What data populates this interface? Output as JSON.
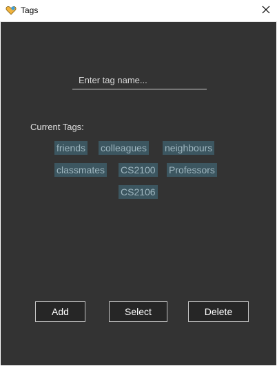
{
  "window": {
    "title": "Tags",
    "close_icon": "close-icon",
    "app_icon": "heart-app-icon",
    "app_icon_colors": [
      "#f2b33d",
      "#3aa0e0"
    ]
  },
  "input": {
    "placeholder": "Enter tag name...",
    "value": ""
  },
  "current_tags_label": "Current Tags:",
  "tags": [
    "friends",
    "colleagues",
    "neighbours",
    "classmates",
    "CS2100",
    "Professors",
    "CS2106"
  ],
  "buttons": {
    "add": "Add",
    "select": "Select",
    "delete": "Delete"
  },
  "colors": {
    "background": "#333333",
    "tag_background": "#3c5660",
    "tag_text": "#9fb6bf"
  }
}
